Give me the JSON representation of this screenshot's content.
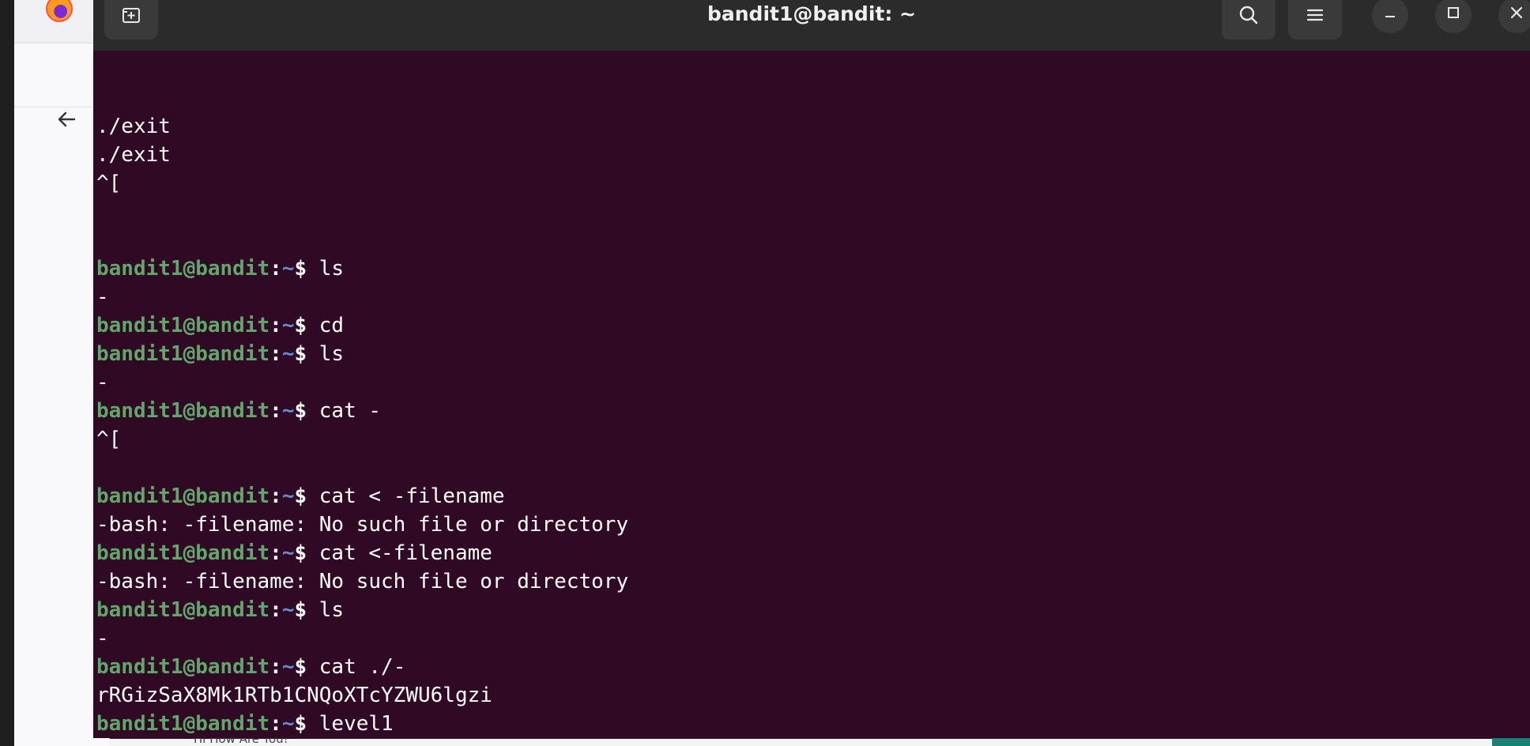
{
  "window": {
    "title": "bandit1@bandit: ~"
  },
  "browser_peek": {
    "content_text": "Hi How Are You!"
  },
  "terminal": {
    "lines": [
      {
        "type": "output",
        "text": "./exit"
      },
      {
        "type": "output",
        "text": "./exit"
      },
      {
        "type": "output",
        "text": "^["
      },
      {
        "type": "blank",
        "text": ""
      },
      {
        "type": "blank",
        "text": ""
      },
      {
        "type": "prompt",
        "user": "bandit1@bandit",
        "path": "~",
        "cmd": " ls"
      },
      {
        "type": "output",
        "text": "-"
      },
      {
        "type": "prompt",
        "user": "bandit1@bandit",
        "path": "~",
        "cmd": " cd"
      },
      {
        "type": "prompt",
        "user": "bandit1@bandit",
        "path": "~",
        "cmd": " ls"
      },
      {
        "type": "output",
        "text": "-"
      },
      {
        "type": "prompt",
        "user": "bandit1@bandit",
        "path": "~",
        "cmd": " cat -"
      },
      {
        "type": "output",
        "text": "^["
      },
      {
        "type": "blank",
        "text": ""
      },
      {
        "type": "prompt",
        "user": "bandit1@bandit",
        "path": "~",
        "cmd": " cat < -filename"
      },
      {
        "type": "output",
        "text": "-bash: -filename: No such file or directory"
      },
      {
        "type": "prompt",
        "user": "bandit1@bandit",
        "path": "~",
        "cmd": " cat <-filename"
      },
      {
        "type": "output",
        "text": "-bash: -filename: No such file or directory"
      },
      {
        "type": "prompt",
        "user": "bandit1@bandit",
        "path": "~",
        "cmd": " ls"
      },
      {
        "type": "output",
        "text": "-"
      },
      {
        "type": "prompt",
        "user": "bandit1@bandit",
        "path": "~",
        "cmd": " cat ./-"
      },
      {
        "type": "output",
        "text": "rRGizSaX8Mk1RTb1CNQoXTcYZWU6lgzi"
      },
      {
        "type": "prompt",
        "user": "bandit1@bandit",
        "path": "~",
        "cmd": " level1"
      }
    ]
  },
  "icons": {
    "new_tab": "new-tab-icon",
    "search": "search-icon",
    "menu": "hamburger-menu-icon",
    "minimize": "minimize-icon",
    "maximize": "maximize-icon",
    "close": "close-icon",
    "back": "back-arrow-icon",
    "browser": "firefox-icon"
  },
  "colors": {
    "terminal_bg": "#300a24",
    "titlebar_bg": "#2b2b2b",
    "prompt_user": "#5fa86a",
    "prompt_path": "#5f8fd0"
  }
}
